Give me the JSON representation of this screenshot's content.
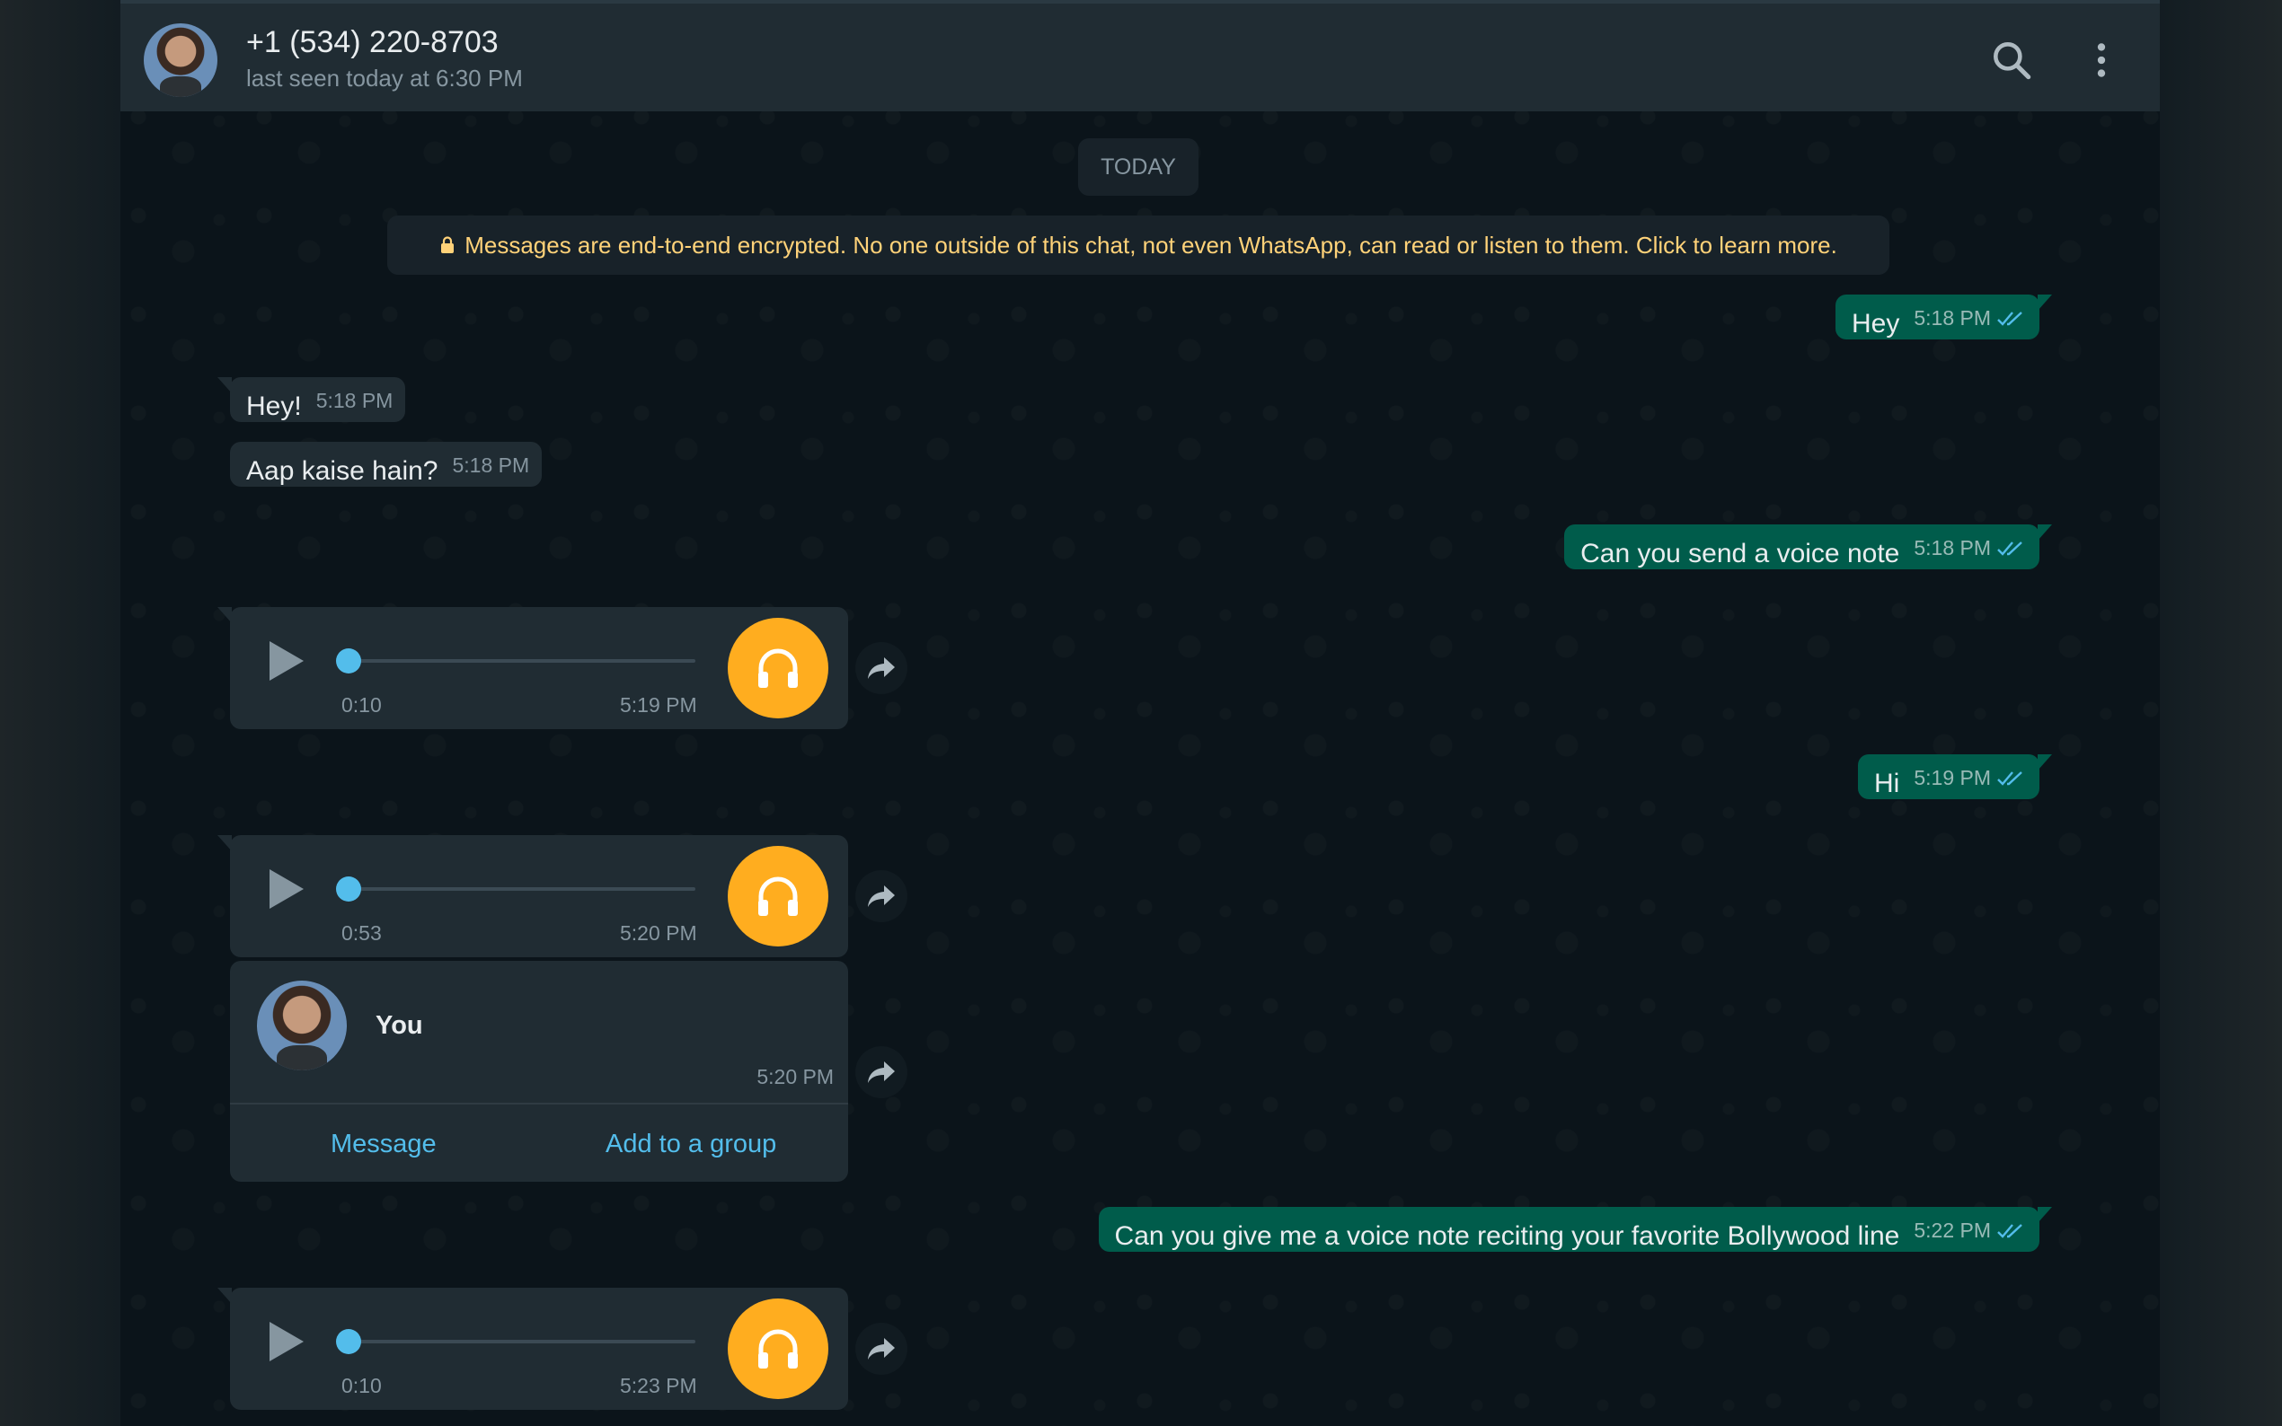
{
  "header": {
    "contact_name": "+1 (534) 220-8703",
    "status": "last seen today at 6:30 PM",
    "avatar_icon": "contact-avatar",
    "search_icon": "search-icon",
    "menu_icon": "more-vertical-icon"
  },
  "chat": {
    "date_chip": "TODAY",
    "encryption_notice": "Messages are end-to-end encrypted. No one outside of this chat, not even WhatsApp, can read or listen to them. Click to learn more.",
    "messages": [
      {
        "direction": "out",
        "text": "Hey",
        "time": "5:18 PM",
        "read": true
      },
      {
        "direction": "in",
        "text": "Hey!",
        "time": "5:18 PM"
      },
      {
        "direction": "in",
        "text": "Aap kaise hain?",
        "time": "5:18 PM"
      },
      {
        "direction": "out",
        "text": "Can you send a voice note",
        "time": "5:18 PM",
        "read": true
      },
      {
        "direction": "in",
        "type": "voice",
        "duration": "0:10",
        "time": "5:19 PM",
        "progress": 0
      },
      {
        "direction": "out",
        "text": "Hi",
        "time": "5:19 PM",
        "read": true
      },
      {
        "direction": "in",
        "type": "voice",
        "duration": "0:53",
        "time": "5:20 PM",
        "progress": 0
      },
      {
        "direction": "in",
        "type": "contact",
        "name": "You",
        "time": "5:20 PM",
        "actions": [
          "Message",
          "Add to a group"
        ]
      },
      {
        "direction": "out",
        "text": "Can you give me a voice note reciting your favorite Bollywood line",
        "time": "5:22 PM",
        "read": true
      },
      {
        "direction": "in",
        "type": "voice",
        "duration": "0:10",
        "time": "5:23 PM",
        "progress": 0
      }
    ]
  },
  "colors": {
    "outgoing_bubble": "#005c4b",
    "incoming_bubble": "#202c33",
    "accent_blue": "#53bdeb",
    "voice_badge": "#ffad1f",
    "notice_text": "#ffd279"
  }
}
